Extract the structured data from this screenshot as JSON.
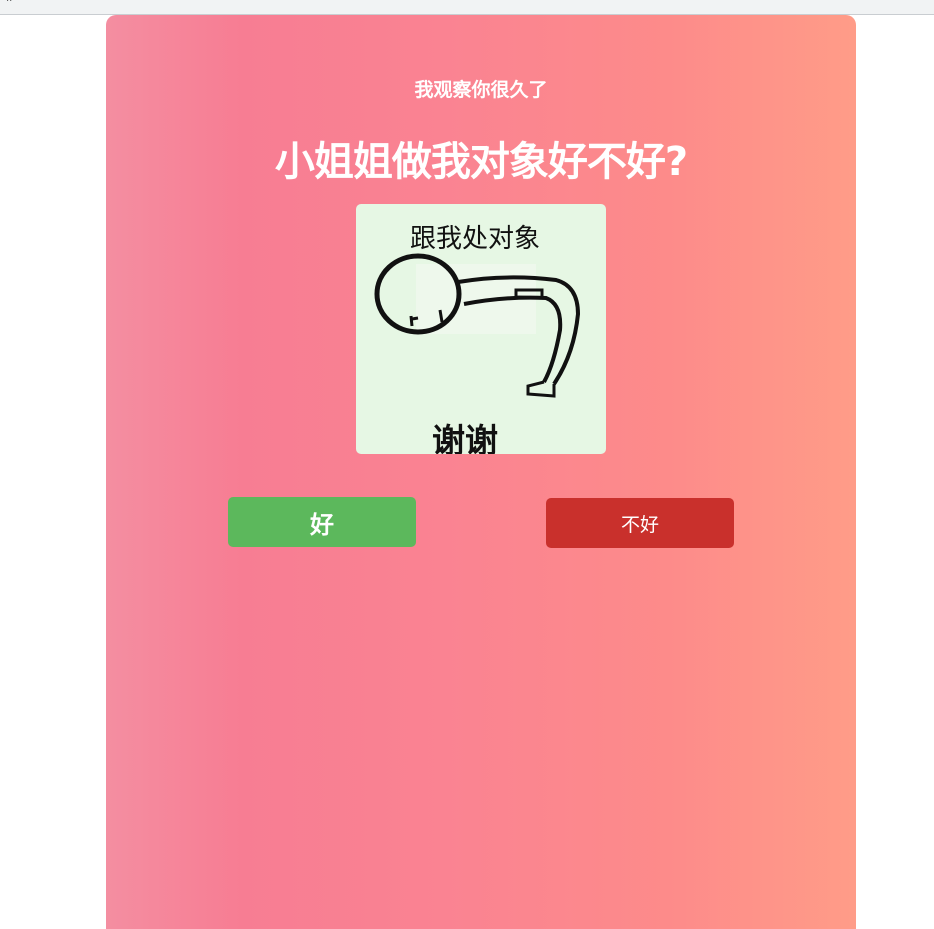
{
  "page": {
    "subtitle": "我观察你很久了",
    "title": "小姐姐做我对象好不好?"
  },
  "meme": {
    "caption_top": "跟我处对象",
    "caption_bottom": "谢谢",
    "icon": "bowing-stickman-drawing"
  },
  "buttons": {
    "yes_label": "好",
    "no_label": "不好"
  },
  "colors": {
    "card_gradient": [
      "#f48ea1",
      "#f77d93",
      "#fa8392",
      "#fd8b8a",
      "#ff9c88"
    ],
    "yes_button": "#5cb85c",
    "no_button": "#c9302c",
    "meme_background": "#e6f7e4"
  }
}
